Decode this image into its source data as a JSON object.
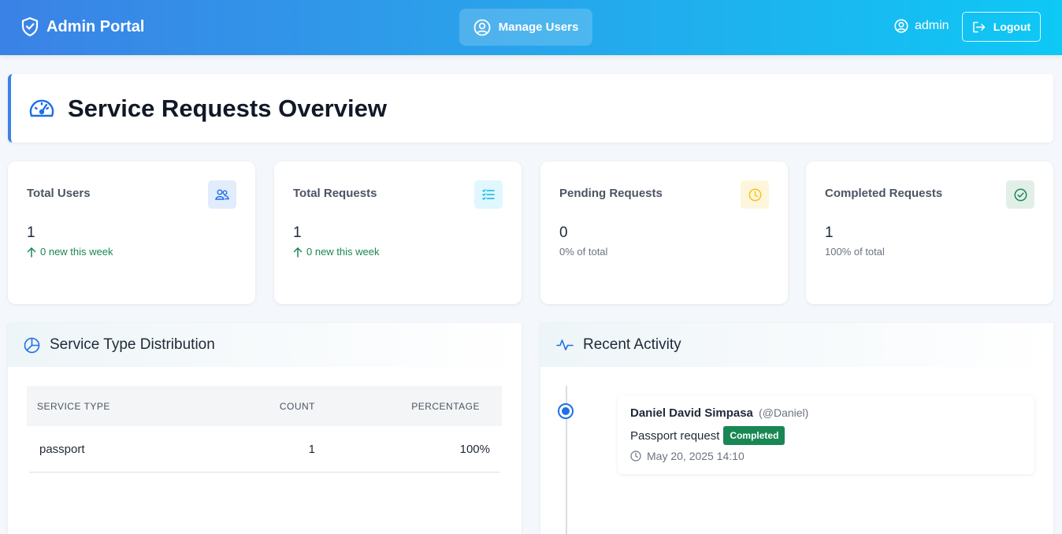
{
  "navbar": {
    "brand": "Admin Portal",
    "manage_users": "Manage Users",
    "username": "admin",
    "logout": "Logout"
  },
  "header": {
    "title": "Service Requests Overview"
  },
  "stats": [
    {
      "label": "Total Users",
      "value": "1",
      "sub": "0 new this week",
      "icon": "users-icon"
    },
    {
      "label": "Total Requests",
      "value": "1",
      "sub": "0 new this week",
      "icon": "list-check-icon"
    },
    {
      "label": "Pending Requests",
      "value": "0",
      "sub": "0% of total",
      "icon": "clock-icon"
    },
    {
      "label": "Completed Requests",
      "value": "1",
      "sub": "100% of total",
      "icon": "check-circle-icon"
    }
  ],
  "distribution": {
    "title": "Service Type Distribution",
    "columns": [
      "SERVICE TYPE",
      "COUNT",
      "PERCENTAGE"
    ],
    "rows": [
      {
        "type": "passport",
        "count": "1",
        "percentage": "100%"
      }
    ]
  },
  "activity": {
    "title": "Recent Activity",
    "items": [
      {
        "name": "Daniel David Simpasa",
        "handle": "(@Daniel)",
        "description": "Passport request",
        "status": "Completed",
        "time": "May 20, 2025 14:10"
      }
    ]
  },
  "colors": {
    "primary": "#3b82e6",
    "success": "#198754",
    "warning": "#f5c518",
    "info": "#0ec8f5"
  }
}
